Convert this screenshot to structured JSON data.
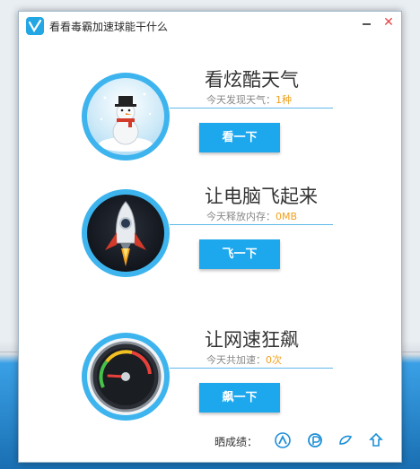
{
  "window": {
    "title": "看看毒霸加速球能干什么"
  },
  "features": [
    {
      "title": "看炫酷天气",
      "sub_label": "今天发现天气：",
      "sub_value": "1种",
      "button": "看一下",
      "image": "snowman-icon"
    },
    {
      "title": "让电脑飞起来",
      "sub_label": "今天释放内存：",
      "sub_value": "0MB",
      "button": "飞一下",
      "image": "rocket-icon"
    },
    {
      "title": "让网速狂飙",
      "sub_label": "今天共加速：",
      "sub_value": "0次",
      "button": "飙一下",
      "image": "speedometer-icon"
    }
  ],
  "footer": {
    "label": "晒成绩：",
    "share_icons": [
      "share-icon-1",
      "share-icon-2",
      "share-icon-3",
      "share-icon-4"
    ]
  },
  "colors": {
    "accent": "#1da8ee",
    "value": "#f0a020",
    "close": "#e64545"
  }
}
